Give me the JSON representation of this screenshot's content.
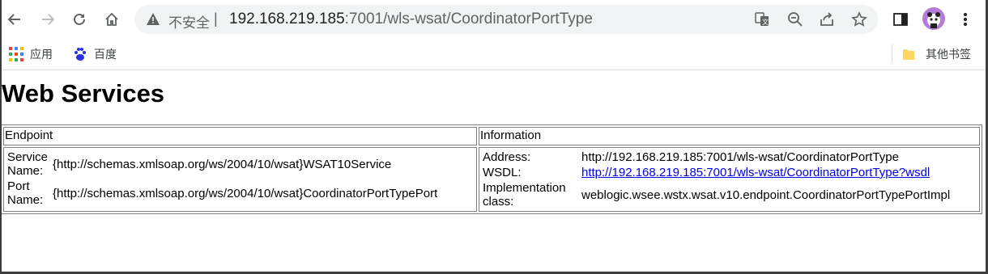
{
  "browser": {
    "insecure_label": "不安全",
    "separator": "|",
    "url_host": "192.168.219.185",
    "url_path": ":7001/wls-wsat/CoordinatorPortType",
    "icons": [
      "back-icon",
      "forward-icon",
      "reload-icon",
      "home-icon",
      "warning-icon",
      "translate-icon",
      "zoom-out-icon",
      "share-icon",
      "star-icon",
      "side-panel-icon",
      "profile-avatar",
      "more-menu-icon"
    ]
  },
  "bookmarks": {
    "apps_label": "应用",
    "baidu_label": "百度",
    "other_label": "其他书签"
  },
  "page": {
    "title": "Web Services",
    "headers": {
      "endpoint": "Endpoint",
      "information": "Information"
    },
    "endpoint": {
      "service_name_label": "Service Name:",
      "service_name_value": "{http://schemas.xmlsoap.org/ws/2004/10/wsat}WSAT10Service",
      "port_name_label": "Port Name:",
      "port_name_value": "{http://schemas.xmlsoap.org/ws/2004/10/wsat}CoordinatorPortTypePort"
    },
    "information": {
      "address_label": "Address:",
      "address_value": "http://192.168.219.185:7001/wls-wsat/CoordinatorPortType",
      "wsdl_label": "WSDL:",
      "wsdl_value": "http://192.168.219.185:7001/wls-wsat/CoordinatorPortType?wsdl",
      "impl_label": "Implementation class:",
      "impl_value": "weblogic.wsee.wstx.wsat.v10.endpoint.CoordinatorPortTypePortImpl"
    }
  },
  "colors": {
    "link": "#0000ee",
    "omnibox_bg": "#f1f3f4",
    "avatar": "#b57cd6"
  }
}
